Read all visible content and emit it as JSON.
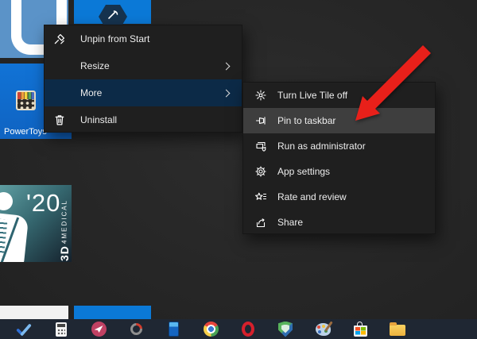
{
  "context_menu": {
    "items": [
      {
        "label": "Unpin from Start",
        "icon": "unpin-icon",
        "has_submenu": false,
        "highlighted": false
      },
      {
        "label": "Resize",
        "icon": "",
        "has_submenu": true,
        "highlighted": false
      },
      {
        "label": "More",
        "icon": "",
        "has_submenu": true,
        "highlighted": true
      },
      {
        "label": "Uninstall",
        "icon": "trash-icon",
        "has_submenu": false,
        "highlighted": false
      }
    ],
    "highlight_color": "#0c2a47"
  },
  "submenu": {
    "items": [
      {
        "label": "Turn Live Tile off",
        "icon": "live-tile-icon",
        "highlighted": false
      },
      {
        "label": "Pin to taskbar",
        "icon": "pin-icon",
        "highlighted": true
      },
      {
        "label": "Run as administrator",
        "icon": "admin-shield-icon",
        "highlighted": false
      },
      {
        "label": "App settings",
        "icon": "gear-icon",
        "highlighted": false
      },
      {
        "label": "Rate and review",
        "icon": "rate-star-icon",
        "highlighted": false
      },
      {
        "label": "Share",
        "icon": "share-icon",
        "highlighted": false
      }
    ],
    "highlight_color": "#3e3e3e"
  },
  "start_menu": {
    "tiles": {
      "powertoys": {
        "label": "PowerToys"
      },
      "anatomy": {
        "year": "'20",
        "brand_prefix": "3D",
        "brand_suffix": "4MEDICAL"
      }
    }
  },
  "annotation": {
    "arrow_color": "#e8201a"
  },
  "taskbar": {
    "icons": [
      "microsoft-todo",
      "calculator",
      "pink-app",
      "loop-app",
      "your-phone",
      "chrome",
      "opera",
      "security-shield",
      "paint-3d",
      "microsoft-store",
      "file-explorer"
    ]
  },
  "colors": {
    "backdrop": "#262626",
    "menu_background": "#1f1f1f",
    "taskbar_background": "#1f2733",
    "tile_blue": "#0b79d7",
    "tile_steel_blue": "#5b93c8",
    "powertoys_tile_blue": "#1173d6"
  }
}
